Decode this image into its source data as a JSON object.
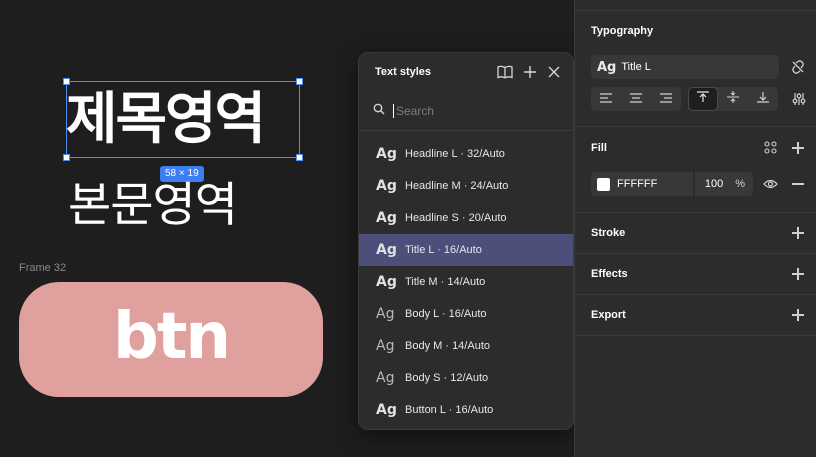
{
  "canvas": {
    "title_text": "제목영역",
    "size_badge": "58 × 19",
    "body_text": "본문영역",
    "frame_label": "Frame 32",
    "button_text": "btn"
  },
  "popover": {
    "title": "Text styles",
    "search_placeholder": "Search",
    "items": [
      {
        "glyph": "Ag",
        "label": "Headline L · 32/Auto"
      },
      {
        "glyph": "Ag",
        "label": "Headline M · 24/Auto"
      },
      {
        "glyph": "Ag",
        "label": "Headline S · 20/Auto"
      },
      {
        "glyph": "Ag",
        "label": "Title L · 16/Auto"
      },
      {
        "glyph": "Ag",
        "label": "Title M · 14/Auto"
      },
      {
        "glyph": "Ag",
        "label": "Body L · 16/Auto"
      },
      {
        "glyph": "Ag",
        "label": "Body M · 14/Auto"
      },
      {
        "glyph": "Ag",
        "label": "Body S · 12/Auto"
      },
      {
        "glyph": "Ag",
        "label": "Button L · 16/Auto"
      }
    ],
    "selected_index": 3,
    "icons": [
      "book-icon",
      "plus-icon",
      "close-icon",
      "search-icon"
    ]
  },
  "panel": {
    "typography": {
      "title": "Typography",
      "style_glyph": "Ag",
      "style_name": "Title L"
    },
    "fill": {
      "title": "Fill",
      "hex": "FFFFFF",
      "opacity": "100",
      "unit": "%",
      "color": "#ffffff"
    },
    "stroke": {
      "title": "Stroke"
    },
    "effects": {
      "title": "Effects"
    },
    "export": {
      "title": "Export"
    }
  },
  "colors": {
    "selection": "#4c8df6",
    "button_fill": "#e0a09e",
    "active_item": "#4b4f7a",
    "panel_bg": "#2c2c2c",
    "canvas_bg": "#1e1e1e"
  }
}
